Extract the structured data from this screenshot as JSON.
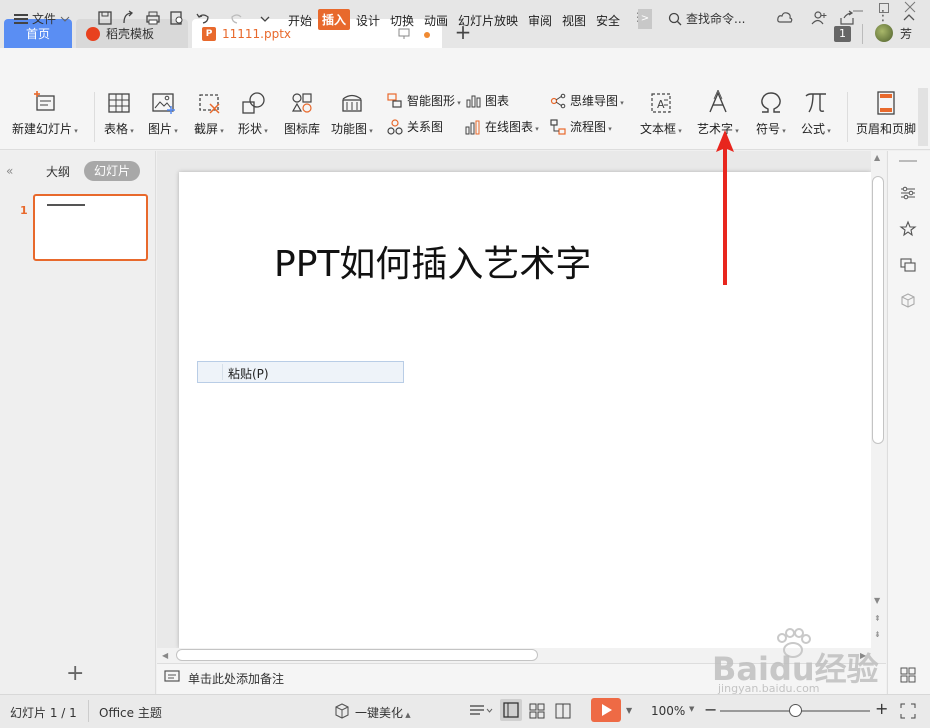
{
  "tabs": {
    "home": "首页",
    "template": "稻壳模板",
    "file": "11111.pptx",
    "new_tab": "+"
  },
  "titlebar": {
    "badge": "1",
    "user": "芳"
  },
  "menu": {
    "file": "文件",
    "tabs": [
      "开始",
      "插入",
      "设计",
      "切换",
      "动画",
      "幻灯片放映",
      "审阅",
      "视图",
      "安全"
    ],
    "more": ">",
    "search": "查找命令..."
  },
  "ribbon": {
    "new_slide": "新建幻灯片",
    "table": "表格",
    "picture": "图片",
    "screenshot": "截屏",
    "shape": "形状",
    "icon_lib": "图标库",
    "func_chart": "功能图",
    "smart_art": "智能图形",
    "chart": "图表",
    "relation": "关系图",
    "online_chart": "在线图表",
    "mind_map": "思维导图",
    "flowchart": "流程图",
    "textbox": "文本框",
    "wordart": "艺术字",
    "symbol": "符号",
    "formula": "公式",
    "header_footer": "页眉和页脚"
  },
  "left": {
    "outline_tab": "大纲",
    "slides_tab": "幻灯片",
    "slide_number": "1",
    "add": "+"
  },
  "slide": {
    "title": "PPT如何插入艺术字"
  },
  "context_menu": {
    "paste": "粘贴(P)"
  },
  "notes": {
    "placeholder": "单击此处添加备注"
  },
  "status": {
    "slide_count": "幻灯片 1 / 1",
    "theme": "Office 主题",
    "beautify": "一键美化",
    "zoom": "100%",
    "minus": "−",
    "plus": "+"
  },
  "watermark": {
    "brand": "Baidu经验",
    "url": "jingyan.baidu.com"
  },
  "colors": {
    "accent": "#e8692c",
    "home_tab": "#5a8ef3",
    "arrow": "#e8261e"
  }
}
